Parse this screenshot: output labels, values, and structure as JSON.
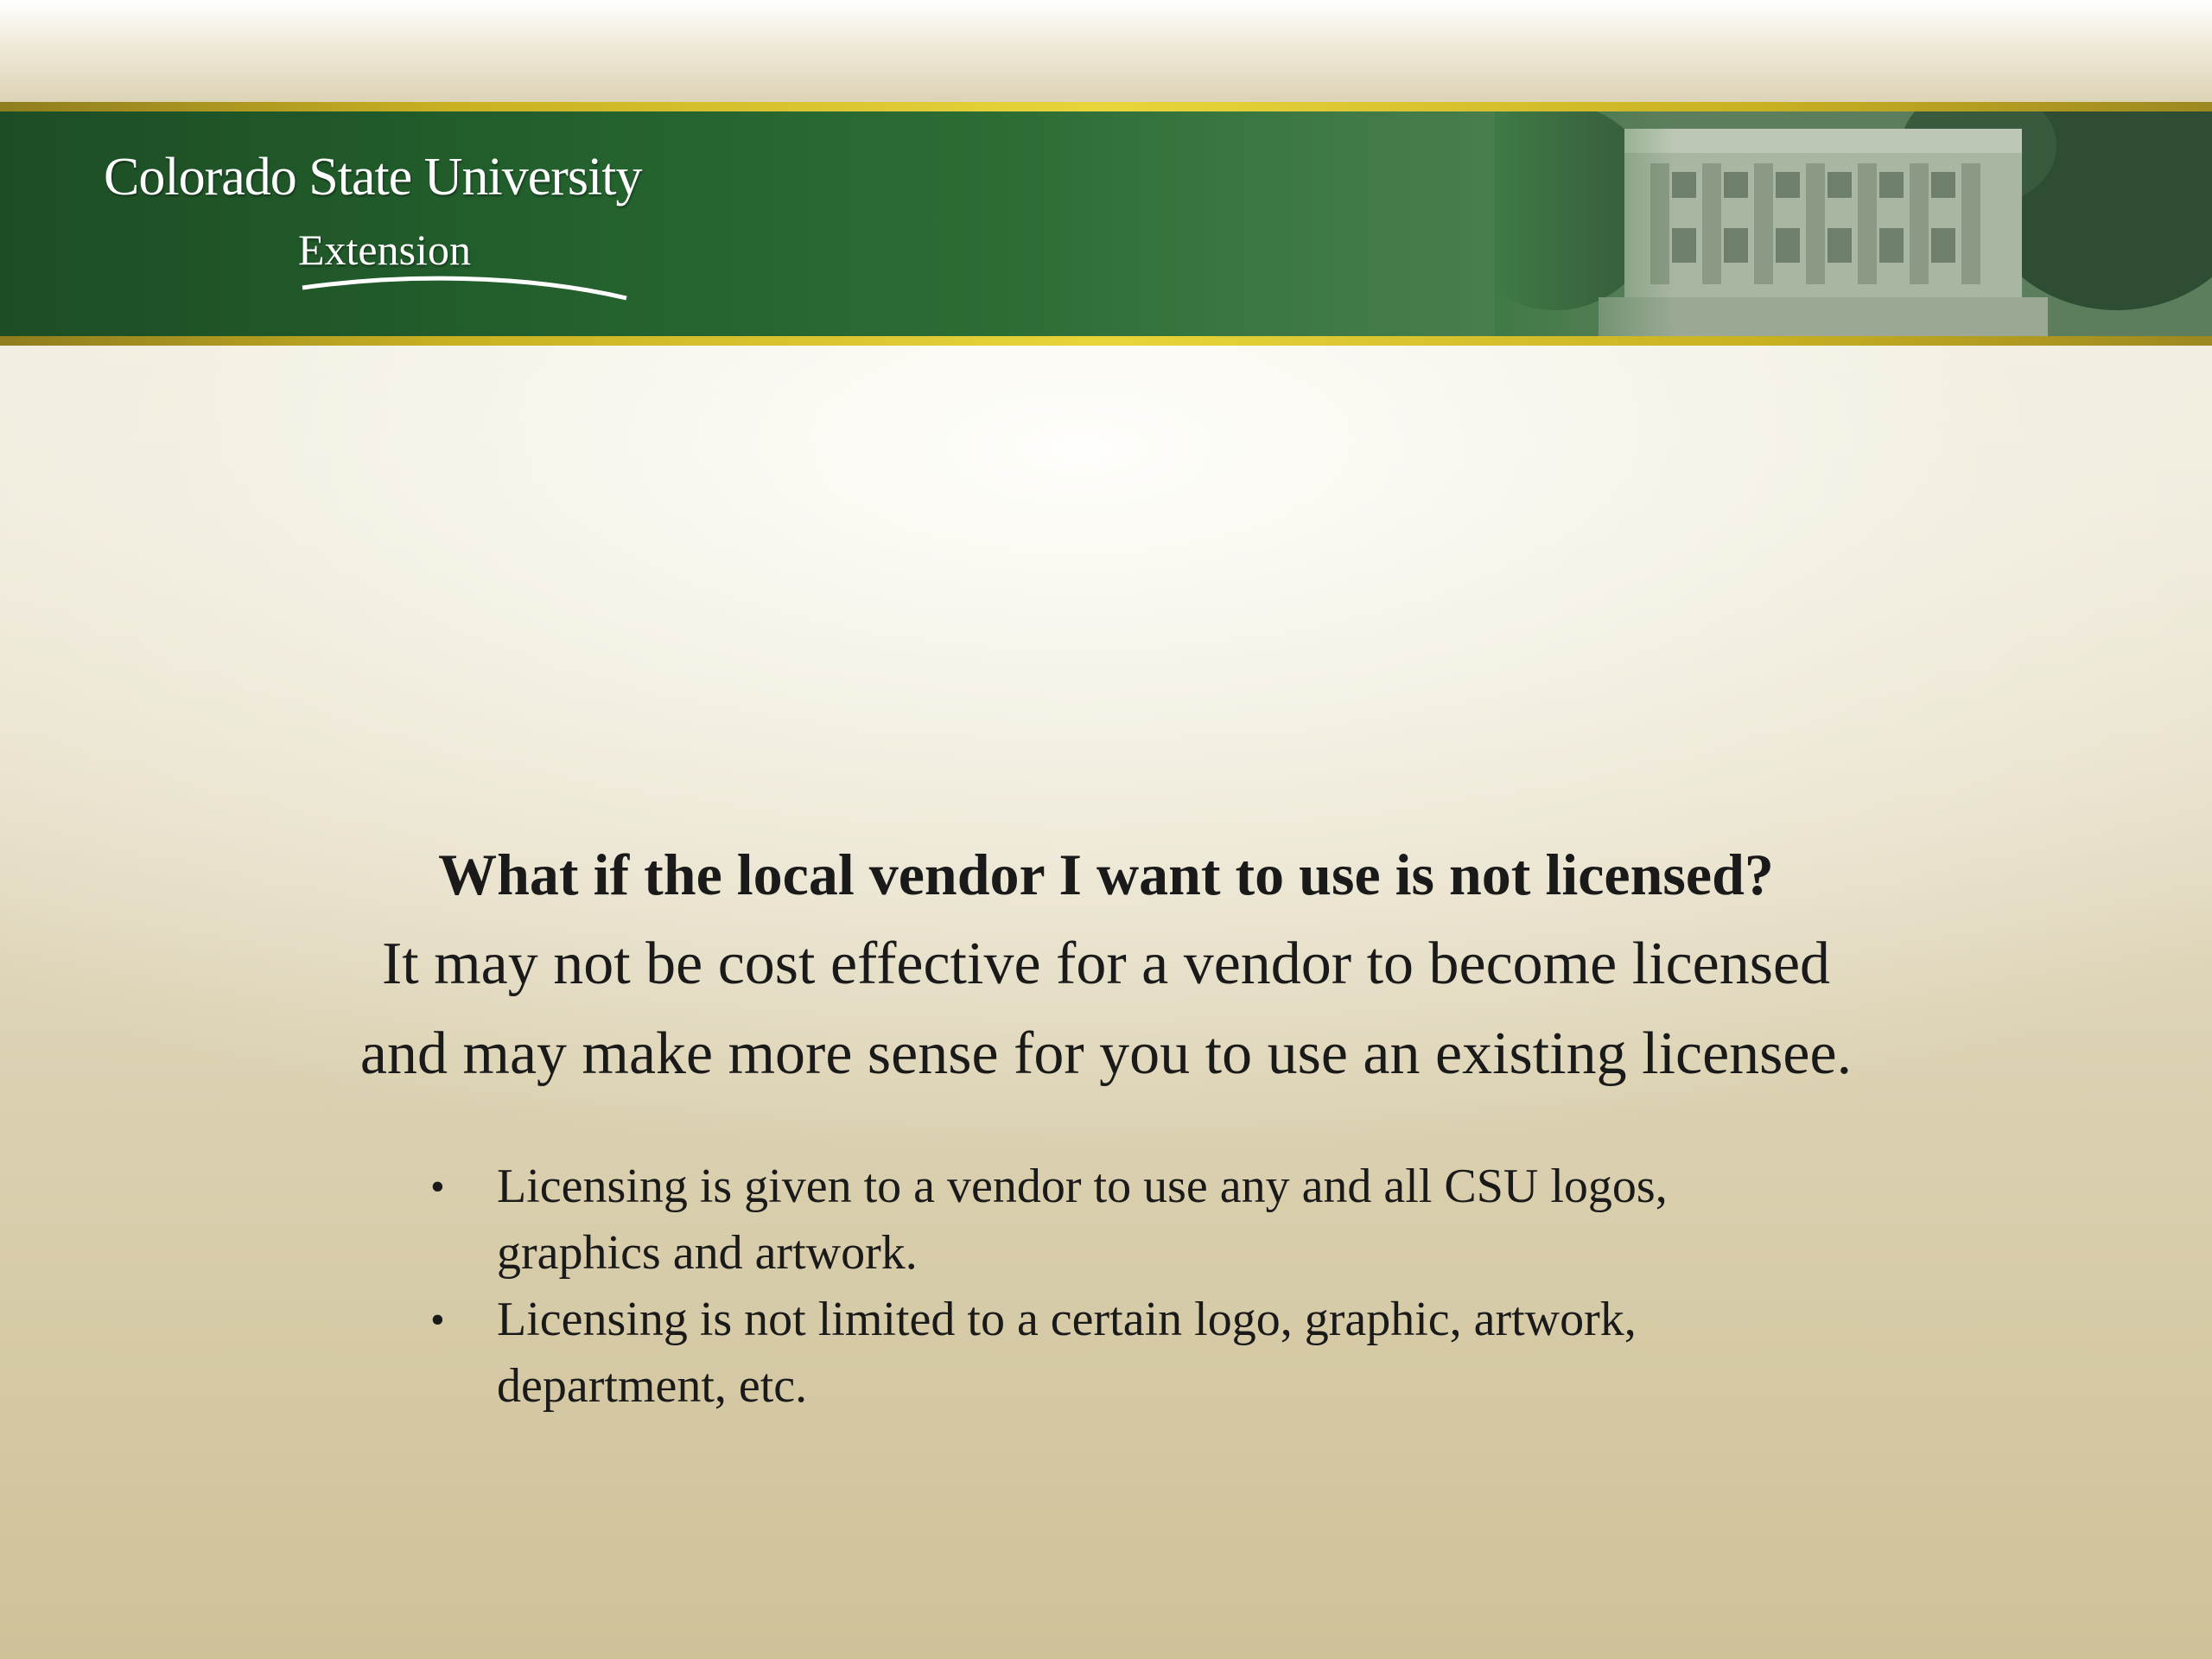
{
  "header": {
    "logo_primary": "Colorado State University",
    "logo_secondary": "Extension"
  },
  "main": {
    "question": "What if  the local vendor I want to use is not licensed?",
    "answer_line1": "It may not be cost effective for a vendor to become licensed",
    "answer_line2": "and may make more sense for you to use an existing licensee.",
    "bullets": [
      {
        "line1": "Licensing is given to a vendor to use any and all CSU logos,",
        "line2": "graphics and artwork."
      },
      {
        "line1": "Licensing is not limited to a certain logo, graphic, artwork,",
        "line2": "department, etc."
      }
    ],
    "bullet_glyph": "•"
  },
  "colors": {
    "header_green": "#23602d",
    "gold": "#e8d53a",
    "text": "#1a1a1a"
  }
}
